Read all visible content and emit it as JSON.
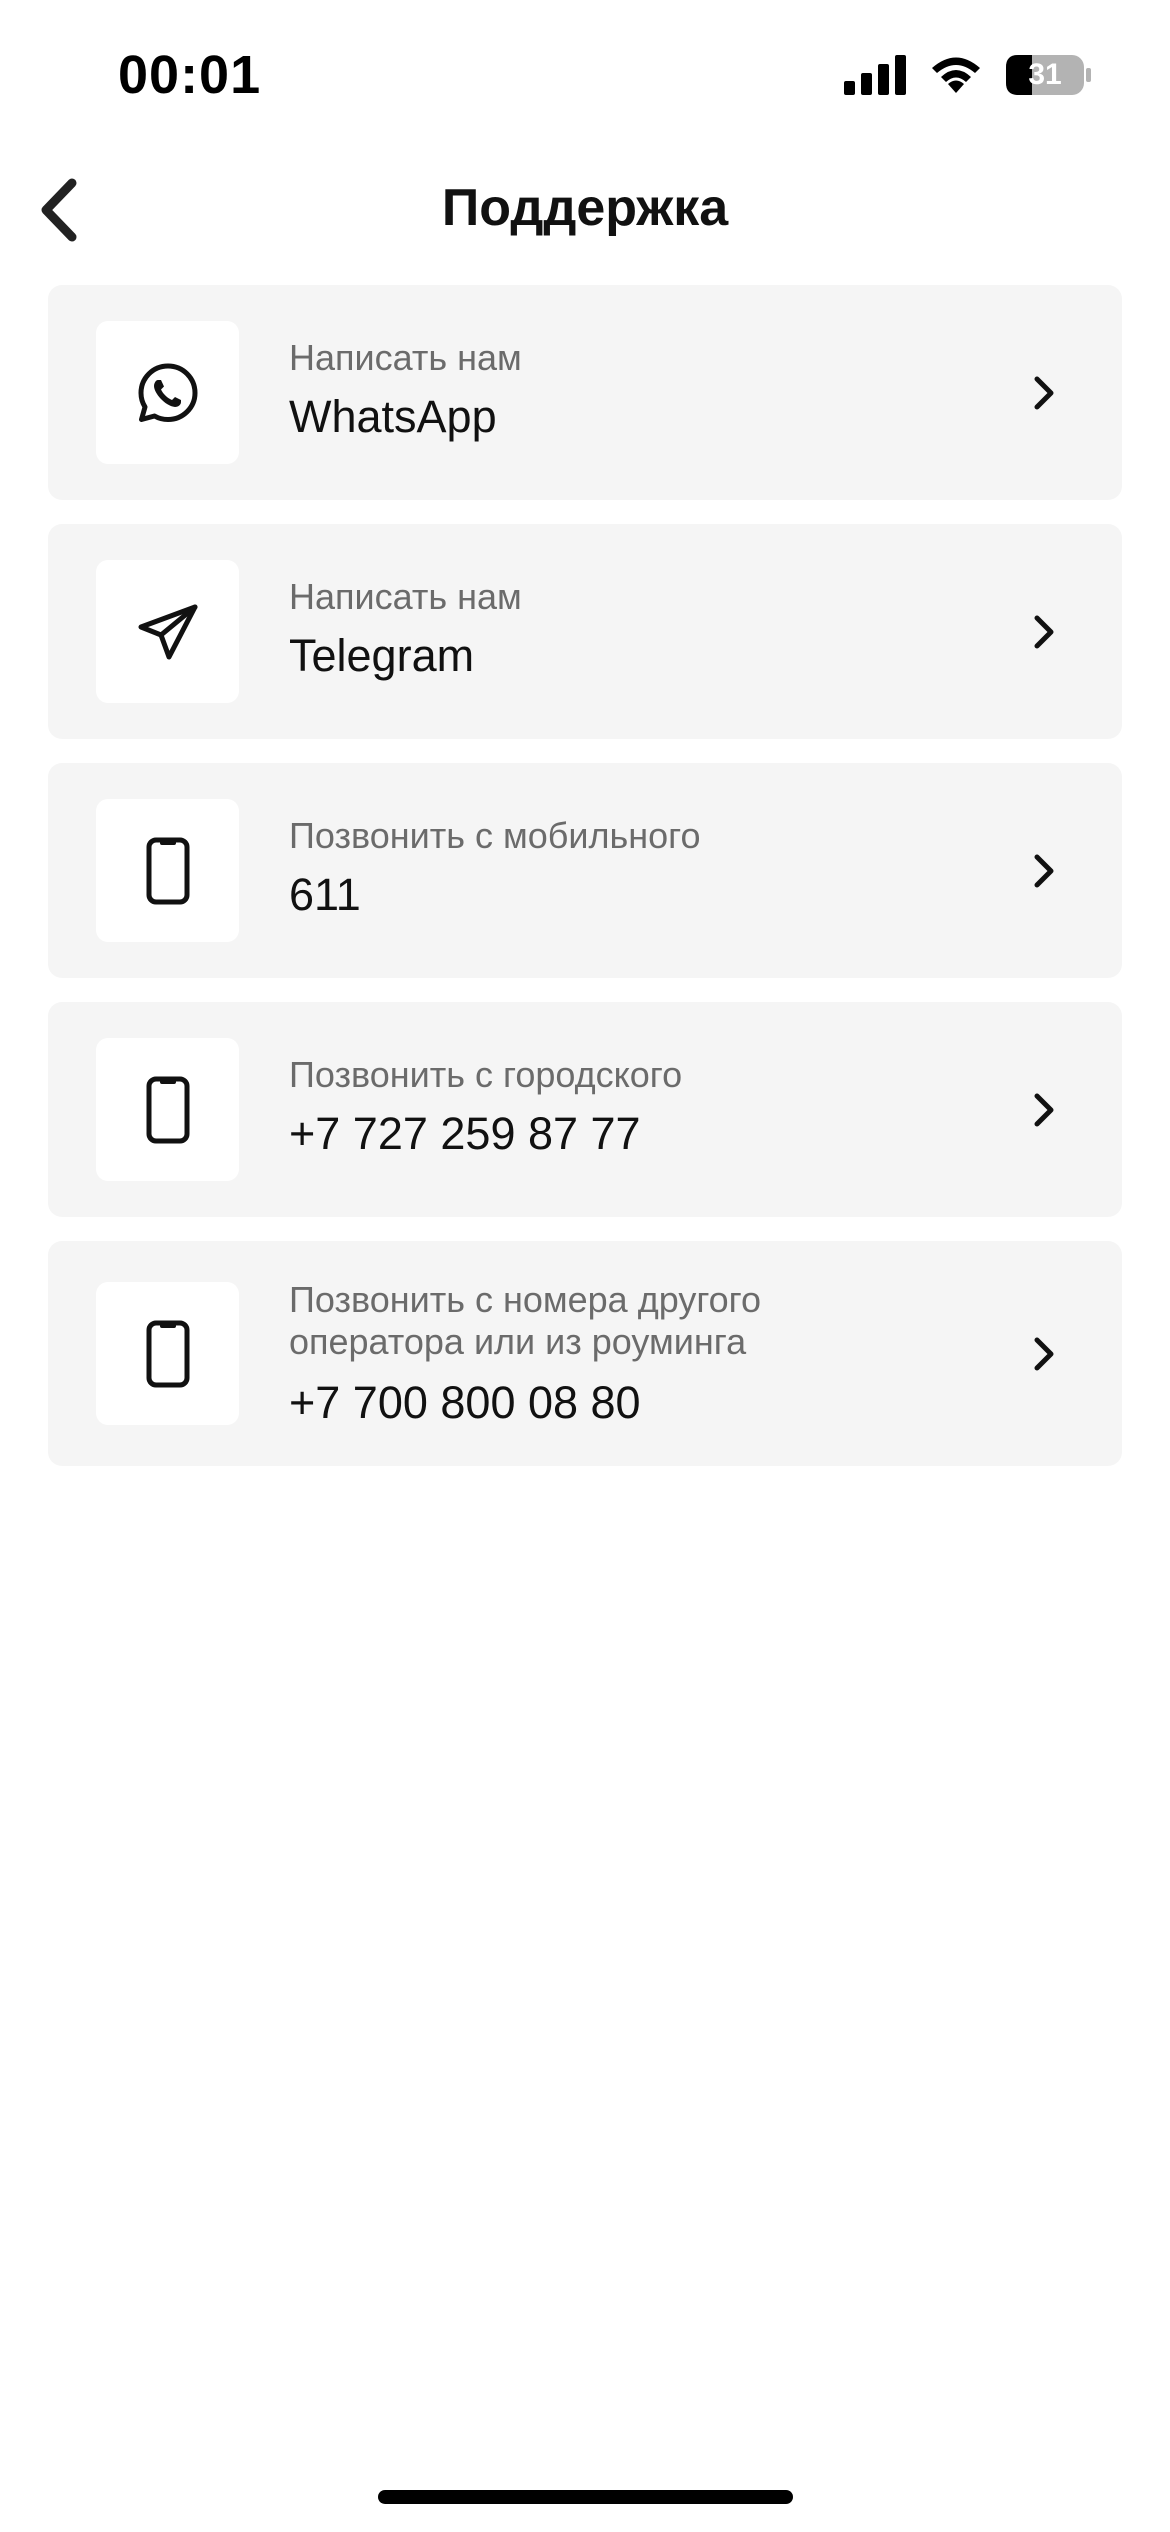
{
  "status_bar": {
    "time": "00:01",
    "battery": "31",
    "icons": [
      "signal-icon",
      "wifi-icon",
      "battery-icon"
    ]
  },
  "header": {
    "title": "Поддержка",
    "back_icon": "chevron-left-icon"
  },
  "items": [
    {
      "label": "Написать нам",
      "value": "WhatsApp",
      "icon": "whatsapp-icon"
    },
    {
      "label": "Написать нам",
      "value": "Telegram",
      "icon": "telegram-icon"
    },
    {
      "label": "Позвонить с мобильного",
      "value": "611",
      "icon": "mobile-phone-icon"
    },
    {
      "label": "Позвонить с городского",
      "value": "+7 727 259 87 77",
      "icon": "mobile-phone-icon"
    },
    {
      "label": "Позвонить с номера другого\nоператора или из роуминга",
      "value": "+7 700 800 08 80",
      "icon": "mobile-phone-icon"
    }
  ],
  "colors": {
    "card_background": "#f5f5f5",
    "label_text": "#6b6b6b",
    "value_text": "#111111"
  }
}
